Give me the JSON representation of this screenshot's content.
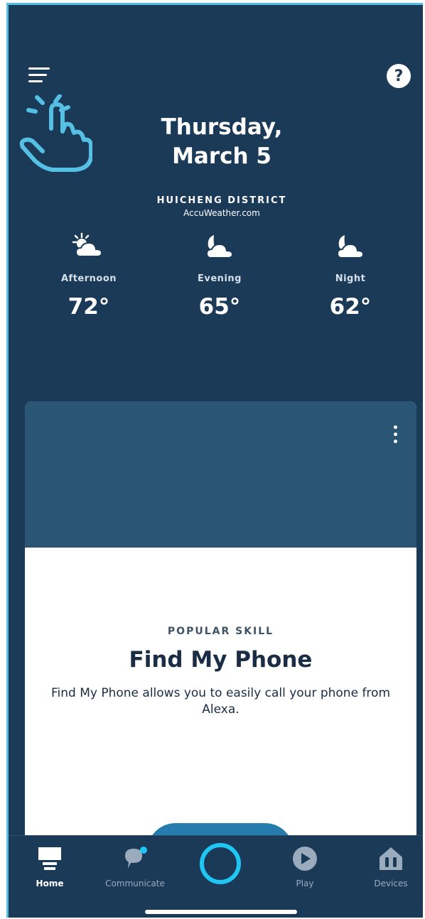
{
  "header": {
    "date_line1": "Thursday,",
    "date_line2": "March 5"
  },
  "weather": {
    "location": "HUICHENG DISTRICT",
    "source": "AccuWeather.com",
    "forecast": [
      {
        "period": "Afternoon",
        "temp": "72°",
        "icon": "sun-cloud-icon"
      },
      {
        "period": "Evening",
        "temp": "65°",
        "icon": "moon-cloud-icon"
      },
      {
        "period": "Night",
        "temp": "62°",
        "icon": "moon-cloud-icon"
      }
    ]
  },
  "card": {
    "eyebrow": "POPULAR SKILL",
    "title": "Find My Phone",
    "description": "Find My Phone allows you to easily call your phone from Alexa."
  },
  "tabs": [
    {
      "label": "Home",
      "icon": "home-icon",
      "active": true
    },
    {
      "label": "Communicate",
      "icon": "chat-icon",
      "active": false
    },
    {
      "label": "",
      "icon": "alexa-icon",
      "active": false
    },
    {
      "label": "Play",
      "icon": "play-icon",
      "active": false
    },
    {
      "label": "Devices",
      "icon": "devices-icon",
      "active": false
    }
  ],
  "colors": {
    "background": "#1b3a57",
    "card_header": "#2a5575",
    "accent": "#1fc6f4",
    "hint_hand": "#55c0e4"
  }
}
